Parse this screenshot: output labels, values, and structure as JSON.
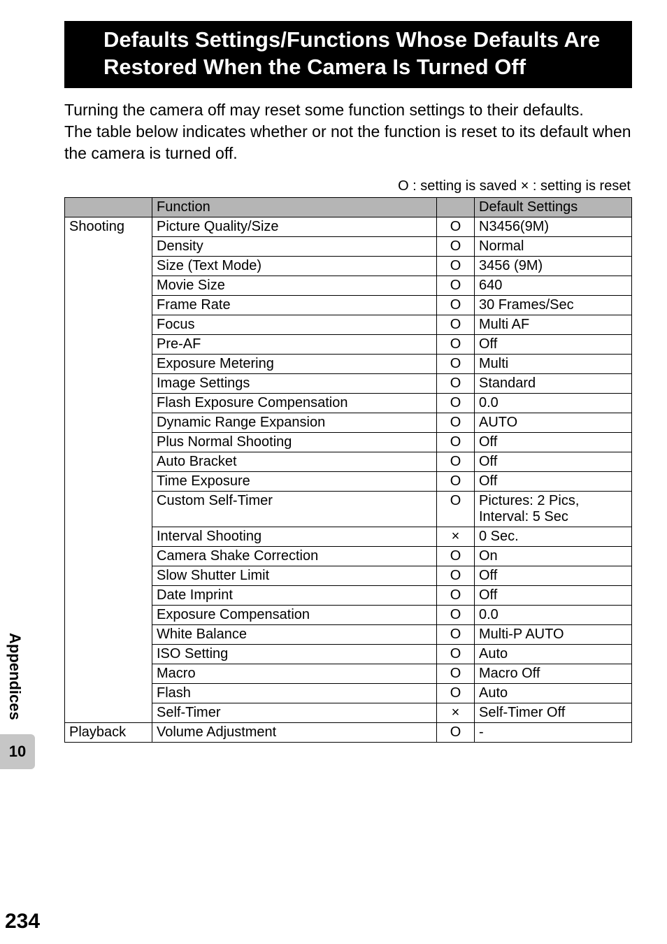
{
  "sidebar": {
    "section_label": "Appendices",
    "tab_number": "10"
  },
  "page_number": "234",
  "title": "Defaults Settings/Functions Whose Defaults Are Restored When the Camera Is Turned Off",
  "intro_line1": "Turning the camera off may reset some function settings to their defaults.",
  "intro_line2": "The table below indicates whether or not the function is reset to its default when the camera is turned off.",
  "legend": "O : setting is saved    × : setting is reset",
  "header": {
    "category": "",
    "function": "Function",
    "mark": "",
    "default": "Default Settings"
  },
  "categories": {
    "shooting": "Shooting",
    "playback": "Playback"
  },
  "rows": {
    "r0": {
      "fn": "Picture Quality/Size",
      "mk": "O",
      "def": "N3456(9M)"
    },
    "r1": {
      "fn": "Density",
      "mk": "O",
      "def": "Normal"
    },
    "r2": {
      "fn": "Size (Text Mode)",
      "mk": "O",
      "def": "3456 (9M)"
    },
    "r3": {
      "fn": "Movie Size",
      "mk": "O",
      "def": "640"
    },
    "r4": {
      "fn": "Frame Rate",
      "mk": "O",
      "def": "30 Frames/Sec"
    },
    "r5": {
      "fn": "Focus",
      "mk": "O",
      "def": "Multi AF"
    },
    "r6": {
      "fn": "Pre-AF",
      "mk": "O",
      "def": "Off"
    },
    "r7": {
      "fn": "Exposure Metering",
      "mk": "O",
      "def": "Multi"
    },
    "r8": {
      "fn": "Image Settings",
      "mk": "O",
      "def": "Standard"
    },
    "r9": {
      "fn": "Flash Exposure Compensation",
      "mk": "O",
      "def": "0.0"
    },
    "r10": {
      "fn": "Dynamic Range Expansion",
      "mk": "O",
      "def": "AUTO"
    },
    "r11": {
      "fn": "Plus Normal Shooting",
      "mk": "O",
      "def": "Off"
    },
    "r12": {
      "fn": "Auto Bracket",
      "mk": "O",
      "def": "Off"
    },
    "r13": {
      "fn": "Time Exposure",
      "mk": "O",
      "def": "Off"
    },
    "r14": {
      "fn": "Custom Self-Timer",
      "mk": "O",
      "def": "Pictures: 2 Pics, Interval: 5 Sec"
    },
    "r15": {
      "fn": "Interval Shooting",
      "mk": "×",
      "def": "0 Sec."
    },
    "r16": {
      "fn": "Camera Shake Correction",
      "mk": "O",
      "def": "On"
    },
    "r17": {
      "fn": "Slow Shutter Limit",
      "mk": "O",
      "def": "Off"
    },
    "r18": {
      "fn": "Date Imprint",
      "mk": "O",
      "def": "Off"
    },
    "r19": {
      "fn": "Exposure Compensation",
      "mk": "O",
      "def": "0.0"
    },
    "r20": {
      "fn": "White Balance",
      "mk": "O",
      "def": "Multi-P AUTO"
    },
    "r21": {
      "fn": "ISO Setting",
      "mk": "O",
      "def": "Auto"
    },
    "r22": {
      "fn": "Macro",
      "mk": "O",
      "def": "Macro Off"
    },
    "r23": {
      "fn": "Flash",
      "mk": "O",
      "def": "Auto"
    },
    "r24": {
      "fn": "Self-Timer",
      "mk": "×",
      "def": "Self-Timer Off"
    },
    "r25": {
      "fn": "Volume Adjustment",
      "mk": "O",
      "def": "-"
    }
  }
}
